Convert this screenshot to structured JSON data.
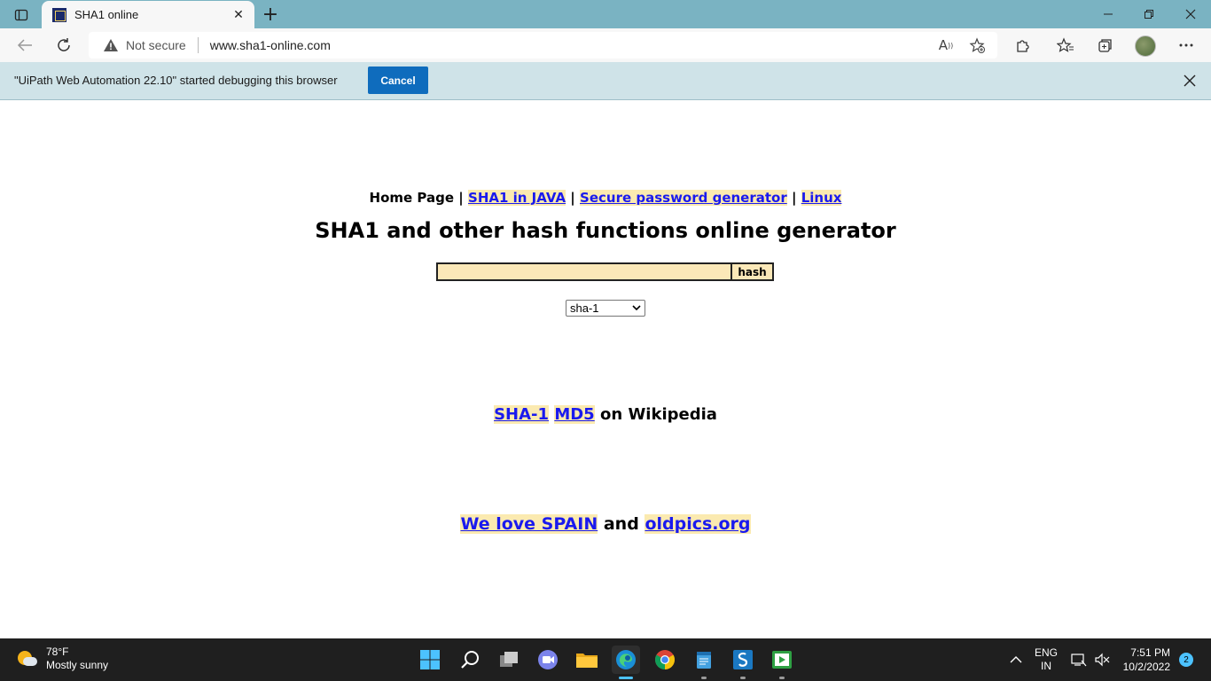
{
  "browser": {
    "tab": {
      "title": "SHA1 online",
      "close": "✕"
    },
    "new_tab": "+",
    "address": {
      "security": "Not secure",
      "url": "www.sha1-online.com"
    },
    "infobar": {
      "message": "\"UiPath Web Automation 22.10\" started debugging this browser",
      "cancel_label": "Cancel"
    }
  },
  "page": {
    "nav": {
      "home": "Home Page",
      "sep": "|",
      "links": [
        "SHA1 in JAVA",
        "Secure password generator",
        "Linux"
      ]
    },
    "heading": "SHA1 and other hash functions online generator",
    "form": {
      "input_value": "",
      "button_label": "hash",
      "select_value": "sha-1"
    },
    "wiki": {
      "link1": "SHA-1",
      "link2": "MD5",
      "suffix": "on Wikipedia"
    },
    "promo": {
      "link1": "We love SPAIN",
      "and": "and",
      "link2": "oldpics.org"
    }
  },
  "taskbar": {
    "weather": {
      "temp": "78°F",
      "condition": "Mostly sunny"
    },
    "lang": {
      "line1": "ENG",
      "line2": "IN"
    },
    "clock": {
      "time": "7:51 PM",
      "date": "10/2/2022"
    },
    "notifications": "2"
  },
  "colors": {
    "titlebar": "#7ab3c2",
    "infobar": "#cfe3e8",
    "link": "#1a1aee",
    "link_bg": "#fbeab0",
    "accent": "#0f6cbd"
  }
}
